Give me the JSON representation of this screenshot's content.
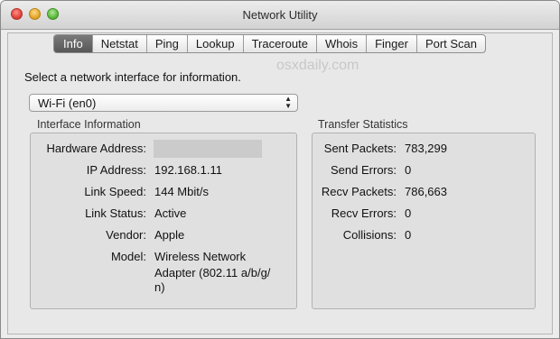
{
  "window": {
    "title": "Network Utility"
  },
  "tabs": [
    {
      "label": "Info",
      "active": true
    },
    {
      "label": "Netstat",
      "active": false
    },
    {
      "label": "Ping",
      "active": false
    },
    {
      "label": "Lookup",
      "active": false
    },
    {
      "label": "Traceroute",
      "active": false
    },
    {
      "label": "Whois",
      "active": false
    },
    {
      "label": "Finger",
      "active": false
    },
    {
      "label": "Port Scan",
      "active": false
    }
  ],
  "watermark": "osxdaily.com",
  "prompt": "Select a network interface for information.",
  "interface_select": {
    "value": "Wi-Fi (en0)"
  },
  "interface_info": {
    "title": "Interface Information",
    "hardware_address_label": "Hardware Address:",
    "ip_label": "IP Address:",
    "ip_value": "192.168.1.11",
    "speed_label": "Link Speed:",
    "speed_value": "144 Mbit/s",
    "status_label": "Link Status:",
    "status_value": "Active",
    "vendor_label": "Vendor:",
    "vendor_value": "Apple",
    "model_label": "Model:",
    "model_value_lines": [
      "Wireless Network",
      "Adapter (802.11 a/b/g/",
      "n)"
    ]
  },
  "transfer_stats": {
    "title": "Transfer Statistics",
    "sent_packets_label": "Sent Packets:",
    "sent_packets_value": "783,299",
    "send_errors_label": "Send Errors:",
    "send_errors_value": "0",
    "recv_packets_label": "Recv Packets:",
    "recv_packets_value": "786,663",
    "recv_errors_label": "Recv Errors:",
    "recv_errors_value": "0",
    "collisions_label": "Collisions:",
    "collisions_value": "0"
  },
  "colors": {
    "window_bg": "#ececec",
    "active_tab": "#666666",
    "close": "#e0443c",
    "minimize": "#e5a82a",
    "zoom": "#5bbb3c"
  }
}
